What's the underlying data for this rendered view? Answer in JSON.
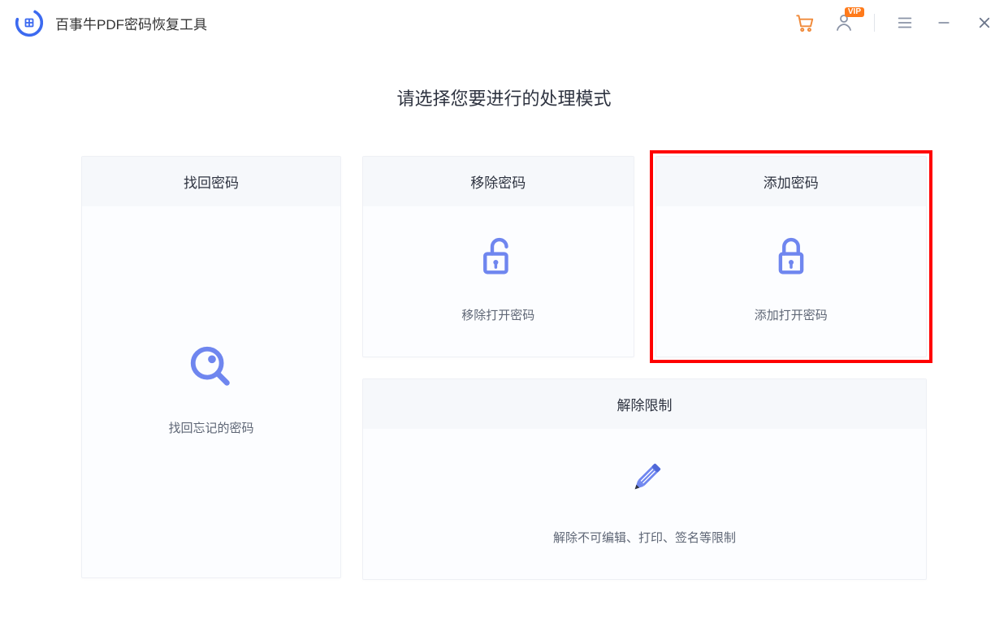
{
  "app": {
    "title": "百事牛PDF密码恢复工具"
  },
  "titlebar": {
    "vip_badge": "VIP"
  },
  "page": {
    "heading": "请选择您要进行的处理模式"
  },
  "cards": {
    "recover": {
      "title": "找回密码",
      "desc": "找回忘记的密码"
    },
    "remove": {
      "title": "移除密码",
      "desc": "移除打开密码"
    },
    "add": {
      "title": "添加密码",
      "desc": "添加打开密码"
    },
    "unlock": {
      "title": "解除限制",
      "desc": "解除不可编辑、打印、签名等限制"
    }
  }
}
